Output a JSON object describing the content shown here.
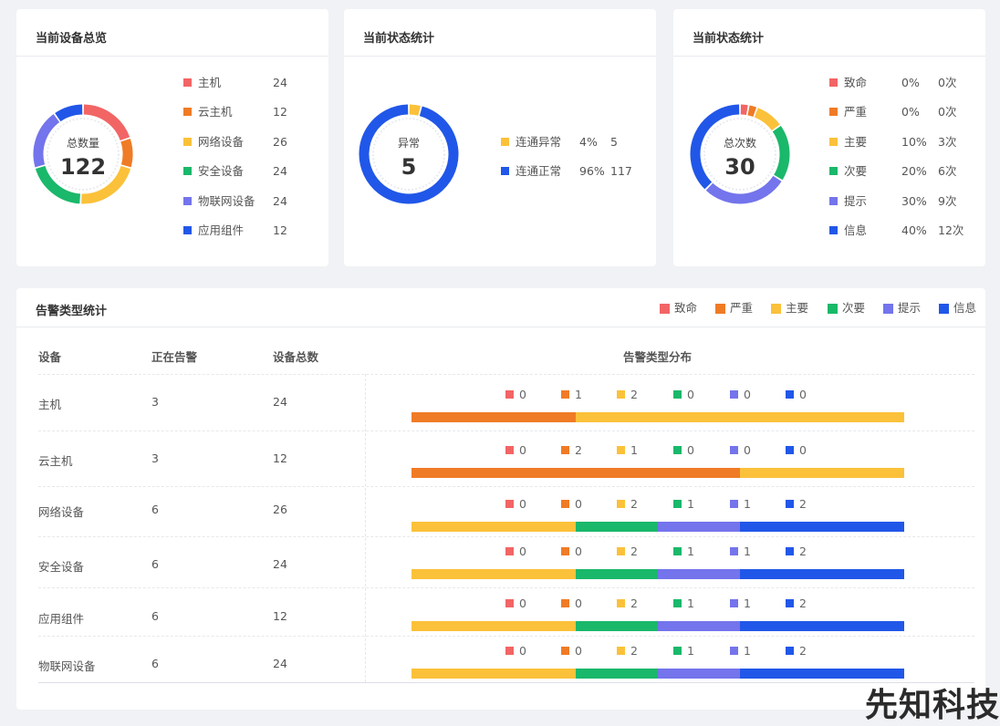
{
  "colors": {
    "fatal": "#f26565",
    "severe": "#f07b26",
    "major": "#fbc13a",
    "minor": "#1ab86a",
    "hint": "#7474ec",
    "info": "#2157e8"
  },
  "overview": {
    "title": "当前设备总览",
    "center_label": "总数量",
    "center_value": "122",
    "items": [
      {
        "label": "主机",
        "value": "24",
        "color": "#f26565"
      },
      {
        "label": "云主机",
        "value": "12",
        "color": "#f07b26"
      },
      {
        "label": "网络设备",
        "value": "26",
        "color": "#fbc13a"
      },
      {
        "label": "安全设备",
        "value": "24",
        "color": "#1ab86a"
      },
      {
        "label": "物联网设备",
        "value": "24",
        "color": "#7474ec"
      },
      {
        "label": "应用组件",
        "value": "12",
        "color": "#2157e8"
      }
    ]
  },
  "status": {
    "title": "当前状态统计",
    "center_label": "异常",
    "center_value": "5",
    "items": [
      {
        "label": "连通异常",
        "percent": "4%",
        "value": "5",
        "color": "#fbc13a"
      },
      {
        "label": "连通正常",
        "percent": "96%",
        "value": "117",
        "color": "#2157e8"
      }
    ]
  },
  "alarm_summary": {
    "title": "当前状态统计",
    "center_label": "总次数",
    "center_value": "30",
    "items": [
      {
        "label": "致命",
        "percent": "0%",
        "count": "0次",
        "color": "#f26565"
      },
      {
        "label": "严重",
        "percent": "0%",
        "count": "0次",
        "color": "#f07b26"
      },
      {
        "label": "主要",
        "percent": "10%",
        "count": "3次",
        "color": "#fbc13a"
      },
      {
        "label": "次要",
        "percent": "20%",
        "count": "6次",
        "color": "#1ab86a"
      },
      {
        "label": "提示",
        "percent": "30%",
        "count": "9次",
        "color": "#7474ec"
      },
      {
        "label": "信息",
        "percent": "40%",
        "count": "12次",
        "color": "#2157e8"
      }
    ]
  },
  "alarm_types": {
    "title": "告警类型统计",
    "legend": [
      {
        "label": "致命",
        "color": "#f26565"
      },
      {
        "label": "严重",
        "color": "#f07b26"
      },
      {
        "label": "主要",
        "color": "#fbc13a"
      },
      {
        "label": "次要",
        "color": "#1ab86a"
      },
      {
        "label": "提示",
        "color": "#7474ec"
      },
      {
        "label": "信息",
        "color": "#2157e8"
      }
    ],
    "headers": {
      "device": "设备",
      "alarming": "正在告警",
      "total": "设备总数",
      "distribution": "告警类型分布"
    },
    "rows": [
      {
        "device": "主机",
        "alarming": "3",
        "total": "24",
        "counts": [
          "0",
          "1",
          "2",
          "0",
          "0",
          "0"
        ]
      },
      {
        "device": "云主机",
        "alarming": "3",
        "total": "12",
        "counts": [
          "0",
          "2",
          "1",
          "0",
          "0",
          "0"
        ]
      },
      {
        "device": "网络设备",
        "alarming": "6",
        "total": "26",
        "counts": [
          "0",
          "0",
          "2",
          "1",
          "1",
          "2"
        ]
      },
      {
        "device": "安全设备",
        "alarming": "6",
        "total": "24",
        "counts": [
          "0",
          "0",
          "2",
          "1",
          "1",
          "2"
        ]
      },
      {
        "device": "应用组件",
        "alarming": "6",
        "total": "12",
        "counts": [
          "0",
          "0",
          "2",
          "1",
          "1",
          "2"
        ]
      },
      {
        "device": "物联网设备",
        "alarming": "6",
        "total": "24",
        "counts": [
          "0",
          "0",
          "2",
          "1",
          "1",
          "2"
        ]
      }
    ]
  },
  "watermark": "先知科技"
}
